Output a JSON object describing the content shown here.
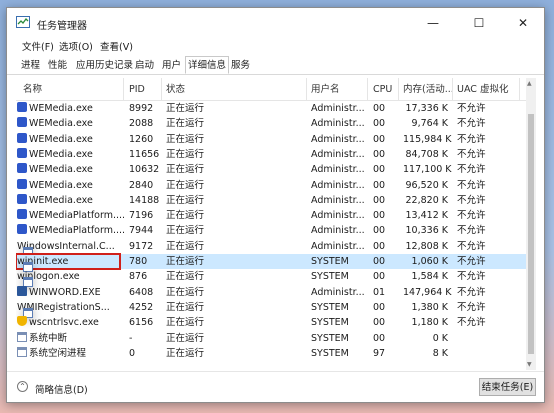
{
  "window": {
    "title": "任务管理器",
    "min": "—",
    "max": "☐",
    "close": "✕"
  },
  "menu": [
    "文件(F)",
    "选项(O)",
    "查看(V)"
  ],
  "tabs": [
    "进程",
    "性能",
    "应用历史记录",
    "启动",
    "用户",
    "详细信息",
    "服务"
  ],
  "active_tab": "详细信息",
  "columns": [
    "名称",
    "PID",
    "状态",
    "用户名",
    "CPU",
    "内存(活动...",
    "UAC 虚拟化"
  ],
  "rows": [
    {
      "name": "WEMedia.exe",
      "pid": "8992",
      "status": "正在运行",
      "user": "Administr...",
      "cpu": "00",
      "mem": "17,336 K",
      "uac": "不允许",
      "icon": "wemedia-icon"
    },
    {
      "name": "WEMedia.exe",
      "pid": "2088",
      "status": "正在运行",
      "user": "Administr...",
      "cpu": "00",
      "mem": "9,764 K",
      "uac": "不允许",
      "icon": "wemedia-icon"
    },
    {
      "name": "WEMedia.exe",
      "pid": "1260",
      "status": "正在运行",
      "user": "Administr...",
      "cpu": "00",
      "mem": "115,984 K",
      "uac": "不允许",
      "icon": "wemedia-icon"
    },
    {
      "name": "WEMedia.exe",
      "pid": "11656",
      "status": "正在运行",
      "user": "Administr...",
      "cpu": "00",
      "mem": "84,708 K",
      "uac": "不允许",
      "icon": "wemedia-icon"
    },
    {
      "name": "WEMedia.exe",
      "pid": "10632",
      "status": "正在运行",
      "user": "Administr...",
      "cpu": "00",
      "mem": "117,100 K",
      "uac": "不允许",
      "icon": "wemedia-icon"
    },
    {
      "name": "WEMedia.exe",
      "pid": "2840",
      "status": "正在运行",
      "user": "Administr...",
      "cpu": "00",
      "mem": "96,520 K",
      "uac": "不允许",
      "icon": "wemedia-icon"
    },
    {
      "name": "WEMedia.exe",
      "pid": "14188",
      "status": "正在运行",
      "user": "Administr...",
      "cpu": "00",
      "mem": "22,820 K",
      "uac": "不允许",
      "icon": "wemedia-icon"
    },
    {
      "name": "WEMediaPlatform....",
      "pid": "7196",
      "status": "正在运行",
      "user": "Administr...",
      "cpu": "00",
      "mem": "13,412 K",
      "uac": "不允许",
      "icon": "wemedia-icon"
    },
    {
      "name": "WEMediaPlatform....",
      "pid": "7944",
      "status": "正在运行",
      "user": "Administr...",
      "cpu": "00",
      "mem": "10,336 K",
      "uac": "不允许",
      "icon": "wemedia-icon"
    },
    {
      "name": "WindowsInternal.C...",
      "pid": "9172",
      "status": "正在运行",
      "user": "Administr...",
      "cpu": "00",
      "mem": "12,808 K",
      "uac": "不允许",
      "icon": "window-icon"
    },
    {
      "name": "wininit.exe",
      "pid": "780",
      "status": "正在运行",
      "user": "SYSTEM",
      "cpu": "00",
      "mem": "1,060 K",
      "uac": "不允许",
      "icon": "window-icon",
      "selected": true
    },
    {
      "name": "winlogon.exe",
      "pid": "876",
      "status": "正在运行",
      "user": "SYSTEM",
      "cpu": "00",
      "mem": "1,584 K",
      "uac": "不允许",
      "icon": "window-icon"
    },
    {
      "name": "WINWORD.EXE",
      "pid": "6408",
      "status": "正在运行",
      "user": "Administr...",
      "cpu": "01",
      "mem": "147,964 K",
      "uac": "不允许",
      "icon": "word-icon"
    },
    {
      "name": "WMIRegistrationS...",
      "pid": "4252",
      "status": "正在运行",
      "user": "SYSTEM",
      "cpu": "00",
      "mem": "1,380 K",
      "uac": "不允许",
      "icon": "window-icon"
    },
    {
      "name": "wscntrlsvc.exe",
      "pid": "6156",
      "status": "正在运行",
      "user": "SYSTEM",
      "cpu": "00",
      "mem": "1,180 K",
      "uac": "不允许",
      "icon": "shield-icon"
    },
    {
      "name": "系统中断",
      "pid": "-",
      "status": "正在运行",
      "user": "SYSTEM",
      "cpu": "00",
      "mem": "0 K",
      "uac": "",
      "icon": "system-icon"
    },
    {
      "name": "系统空闲进程",
      "pid": "0",
      "status": "正在运行",
      "user": "SYSTEM",
      "cpu": "97",
      "mem": "8 K",
      "uac": "",
      "icon": "system-icon"
    }
  ],
  "footer": {
    "fewer_details": "简略信息(D)",
    "end_task": "结束任务(E)"
  }
}
